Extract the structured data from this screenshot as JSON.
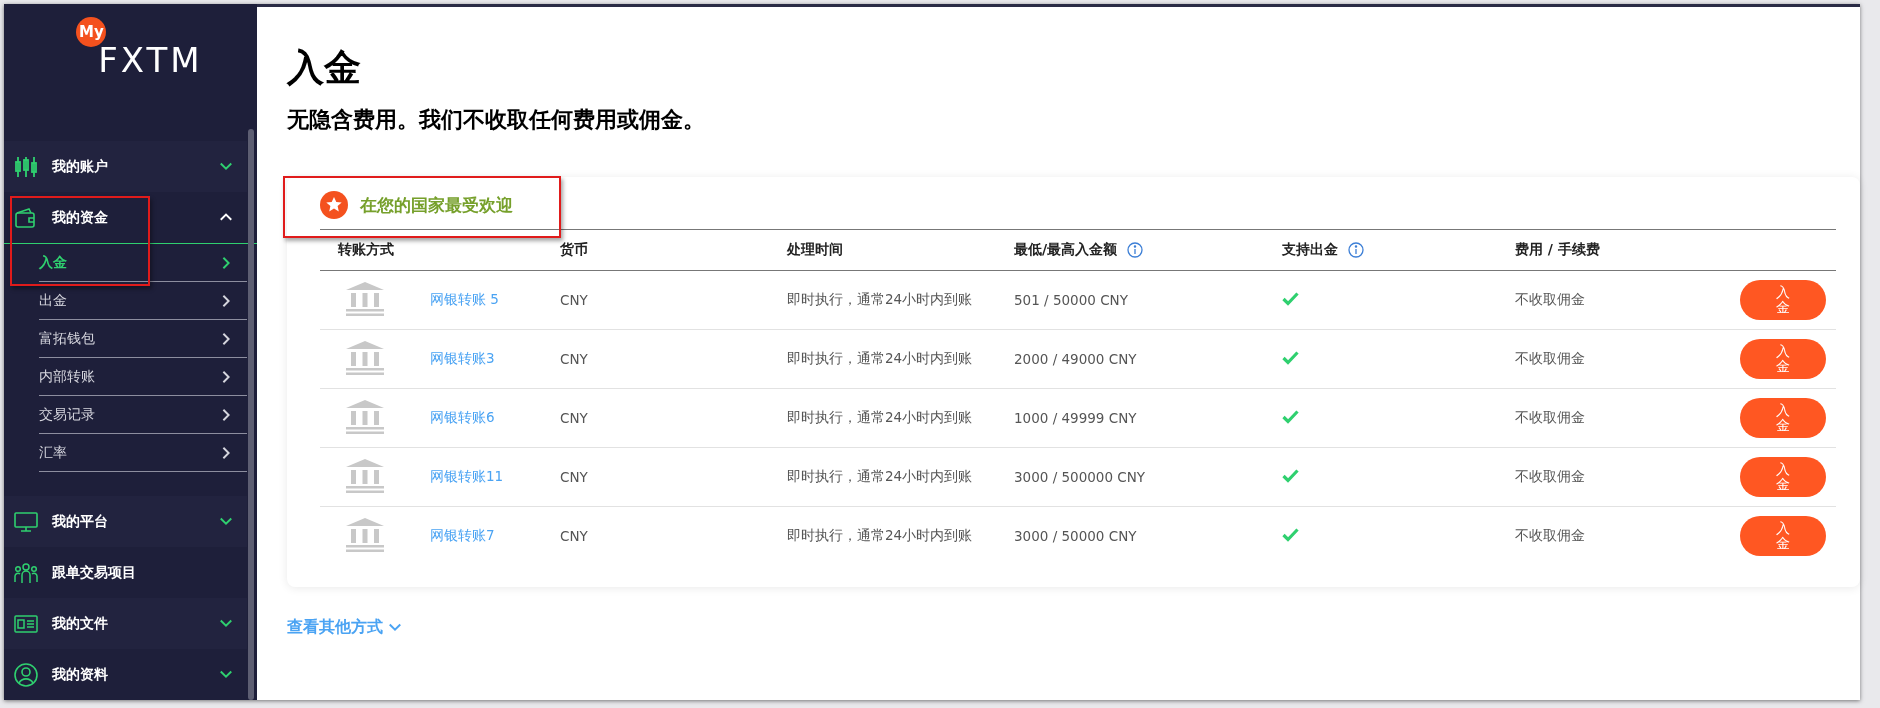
{
  "sidebar": {
    "logo": {
      "badge": "My",
      "text": "FXTM"
    },
    "items": [
      {
        "label": "我的账户",
        "expanded": false
      },
      {
        "label": "我的资金",
        "expanded": true,
        "children": [
          {
            "label": "入金",
            "selected": true
          },
          {
            "label": "出金",
            "selected": false
          },
          {
            "label": "富拓钱包",
            "selected": false
          },
          {
            "label": "内部转账",
            "selected": false
          },
          {
            "label": "交易记录",
            "selected": false
          },
          {
            "label": "汇率",
            "selected": false
          }
        ]
      },
      {
        "label": "我的平台",
        "expanded": false
      },
      {
        "label": "跟单交易项目"
      },
      {
        "label": "我的文件",
        "expanded": false
      },
      {
        "label": "我的资料",
        "expanded": false
      }
    ]
  },
  "page": {
    "title": "入金",
    "subtitle": "无隐含费用。我们不收取任何费用或佣金。"
  },
  "card": {
    "title": "在您的国家最受欢迎",
    "table": {
      "columns": [
        {
          "label": "转账方式",
          "info": false
        },
        {
          "label": "货币",
          "info": false
        },
        {
          "label": "处理时间",
          "info": false
        },
        {
          "label": "最低/最高入金额",
          "info": true
        },
        {
          "label": "支持出金",
          "info": true
        },
        {
          "label": "费用 / 手续费",
          "info": false
        }
      ],
      "rows": [
        {
          "method": "网银转账 5",
          "currency": "CNY",
          "time": "即时执行，通常24小时内到账",
          "limits": "501 / 50000 CNY",
          "withdrawal": true,
          "fee": "不收取佣金",
          "button": "入金"
        },
        {
          "method": "网银转账3",
          "currency": "CNY",
          "time": "即时执行，通常24小时内到账",
          "limits": "2000 / 49000 CNY",
          "withdrawal": true,
          "fee": "不收取佣金",
          "button": "入金"
        },
        {
          "method": "网银转账6",
          "currency": "CNY",
          "time": "即时执行，通常24小时内到账",
          "limits": "1000 / 49999 CNY",
          "withdrawal": true,
          "fee": "不收取佣金",
          "button": "入金"
        },
        {
          "method": "网银转账11",
          "currency": "CNY",
          "time": "即时执行，通常24小时内到账",
          "limits": "3000 / 500000 CNY",
          "withdrawal": true,
          "fee": "不收取佣金",
          "button": "入金"
        },
        {
          "method": "网银转账7",
          "currency": "CNY",
          "time": "即时执行，通常24小时内到账",
          "limits": "3000 / 50000 CNY",
          "withdrawal": true,
          "fee": "不收取佣金",
          "button": "入金"
        }
      ]
    }
  },
  "more_link": "查看其他方式"
}
